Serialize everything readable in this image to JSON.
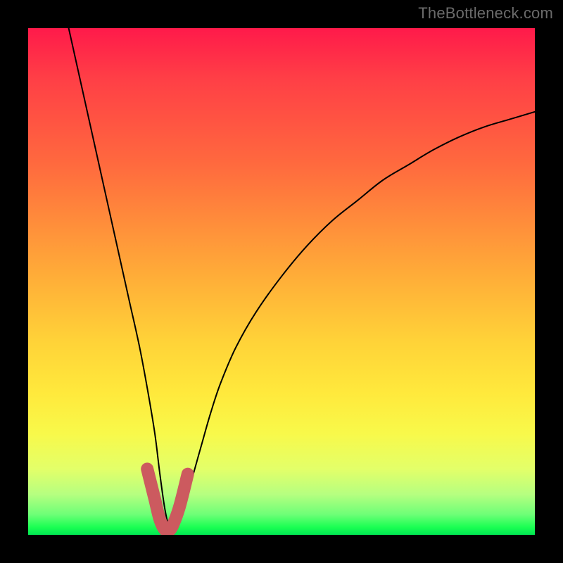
{
  "watermark": "TheBottleneck.com",
  "gradient_colors": {
    "top": "#ff1a4a",
    "mid_upper": "#ff923a",
    "mid": "#ffe93c",
    "mid_lower": "#b6ff80",
    "bottom": "#00e652"
  },
  "accent_color": "#cc5a5f",
  "line_color": "#000000",
  "frame_color": "#000000",
  "chart_data": {
    "type": "line",
    "title": "",
    "xlabel": "",
    "ylabel": "",
    "xlim": [
      0,
      100
    ],
    "ylim": [
      0,
      100
    ],
    "grid": false,
    "legend": null,
    "annotations": [],
    "series": [
      {
        "name": "curve",
        "x": [
          8,
          10,
          12,
          14,
          16,
          18,
          20,
          22,
          23.5,
          25,
          26,
          27,
          28,
          29,
          30,
          32,
          34,
          36,
          38,
          41,
          45,
          50,
          55,
          60,
          65,
          70,
          75,
          80,
          85,
          90,
          95,
          100
        ],
        "y": [
          100,
          91,
          82,
          73,
          64,
          55,
          46,
          37,
          29,
          20,
          12,
          5,
          1,
          1,
          4,
          10,
          17,
          24,
          30,
          37,
          44,
          51,
          57,
          62,
          66,
          70,
          73,
          76,
          78.5,
          80.5,
          82,
          83.5
        ]
      },
      {
        "name": "accent_segment",
        "x": [
          23.5,
          25,
          26,
          27,
          28,
          29,
          30,
          31.5
        ],
        "y": [
          13,
          7,
          3,
          1,
          1,
          3,
          6,
          12
        ]
      }
    ]
  }
}
